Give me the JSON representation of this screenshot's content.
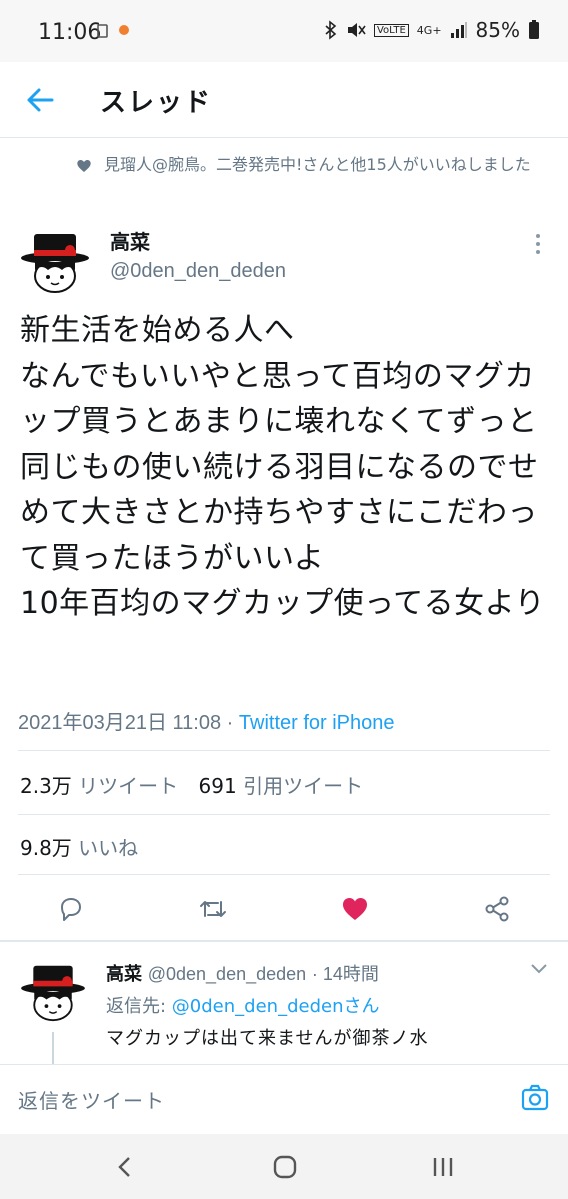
{
  "status_bar": {
    "time": "11:06",
    "battery": "85%",
    "signal_label": "4G+",
    "volte_label": "VoLTE"
  },
  "header": {
    "title": "スレッド"
  },
  "social_context": {
    "text": "見瑠人@腕鳥。二巻発売中!さんと他15人がいいねしました"
  },
  "tweet": {
    "author_name": "高菜",
    "author_handle": "@0den_den_deden",
    "text": "新生活を始める人へ\nなんでもいいやと思って百均のマグカップ買うとあまりに壊れなくてずっと同じもの使い続ける羽目になるのでせめて大きさとか持ちやすさにこだわって買ったほうがいいよ\n10年百均のマグカップ使ってる女より",
    "timestamp": "2021年03月21日 11:08",
    "separator": " · ",
    "via": "Twitter for iPhone",
    "retweets_count": "2.3万",
    "retweets_label": "リツイート",
    "quotes_count": "691",
    "quotes_label": "引用ツイート",
    "likes_count": "9.8万",
    "likes_label": "いいね"
  },
  "reply": {
    "author_name": "高菜",
    "author_handle": "@0den_den_deden",
    "time_ago": "14時間",
    "reply_to_prefix": "返信先: ",
    "reply_to_handle": "@0den_den_dedenさん",
    "text": "マグカップは出て来ませんが御茶ノ水"
  },
  "compose": {
    "placeholder": "返信をツイート"
  },
  "colors": {
    "accent": "#1da1f2",
    "like_red": "#e0245e",
    "secondary_text": "#657786",
    "divider": "#e1e8ed"
  },
  "icons": [
    "back-arrow-icon",
    "more-vertical-icon",
    "heart-icon",
    "reply-icon",
    "retweet-icon",
    "share-icon",
    "chevron-down-icon",
    "camera-icon",
    "nav-back-icon",
    "nav-home-icon",
    "nav-recents-icon"
  ]
}
